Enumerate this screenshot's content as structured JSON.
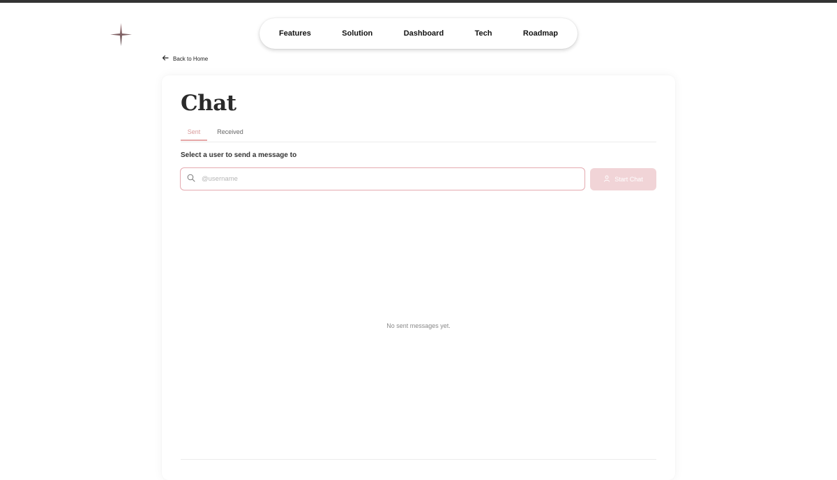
{
  "nav": {
    "items": [
      {
        "label": "Features"
      },
      {
        "label": "Solution"
      },
      {
        "label": "Dashboard"
      },
      {
        "label": "Tech"
      },
      {
        "label": "Roadmap"
      }
    ]
  },
  "back_link": {
    "label": "Back to Home",
    "icon": "arrow-left-icon"
  },
  "chat": {
    "title": "Chat",
    "tabs": [
      {
        "label": "Sent",
        "active": true
      },
      {
        "label": "Received",
        "active": false
      }
    ],
    "select_label": "Select a user to send a message to",
    "search": {
      "placeholder": "@username",
      "value": "",
      "icon": "search-icon"
    },
    "start_button": {
      "label": "Start Chat",
      "icon": "user-icon",
      "enabled": false
    },
    "empty_message": "No sent messages yet."
  },
  "colors": {
    "accent": "#e5a7a7",
    "button_disabled_bg": "#f1d4d7",
    "topbar": "#333333"
  }
}
